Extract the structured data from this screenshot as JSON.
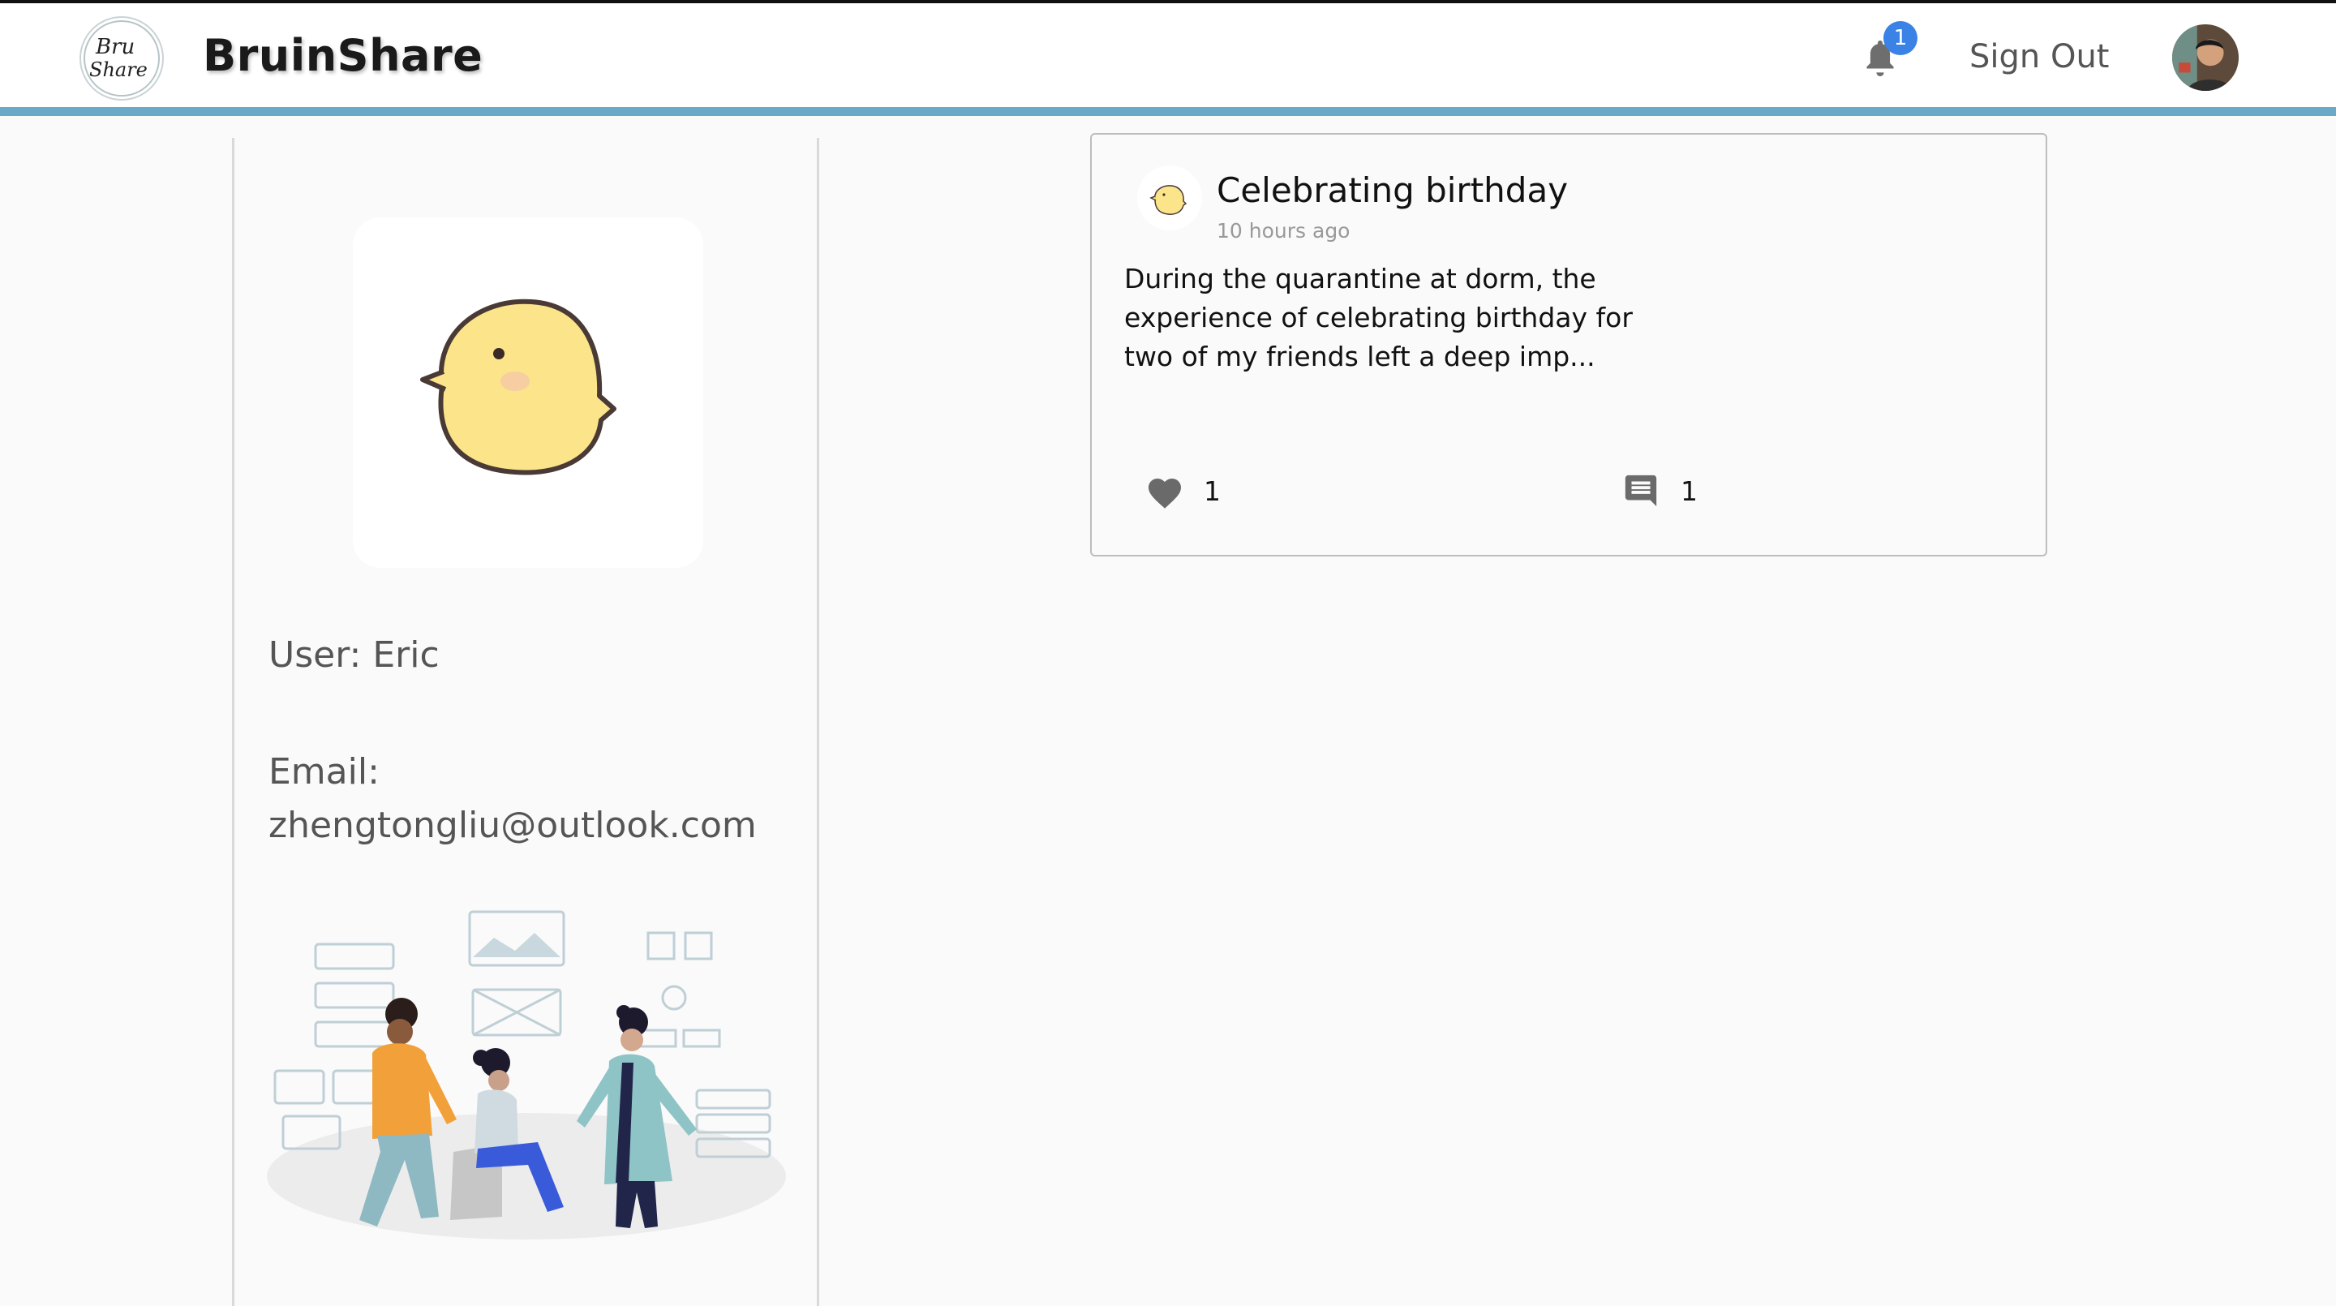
{
  "header": {
    "brand": "BruinShare",
    "logo_text": "Bruin Share",
    "notification_count": "1",
    "sign_out_label": "Sign Out",
    "bell_icon": "bell-icon",
    "accent_color": "#6aa9c8"
  },
  "profile": {
    "user_label": "User: Eric",
    "email_label": "Email:",
    "email_value": "zhengtongliu@outlook.com",
    "avatar_icon": "chick-icon"
  },
  "posts": [
    {
      "title": "Celebrating birthday",
      "time": "10 hours ago",
      "excerpt": "During the quarantine at dorm, the experience of celebrating birthday for two of my friends left a deep imp...",
      "likes": "1",
      "comments": "1"
    }
  ]
}
